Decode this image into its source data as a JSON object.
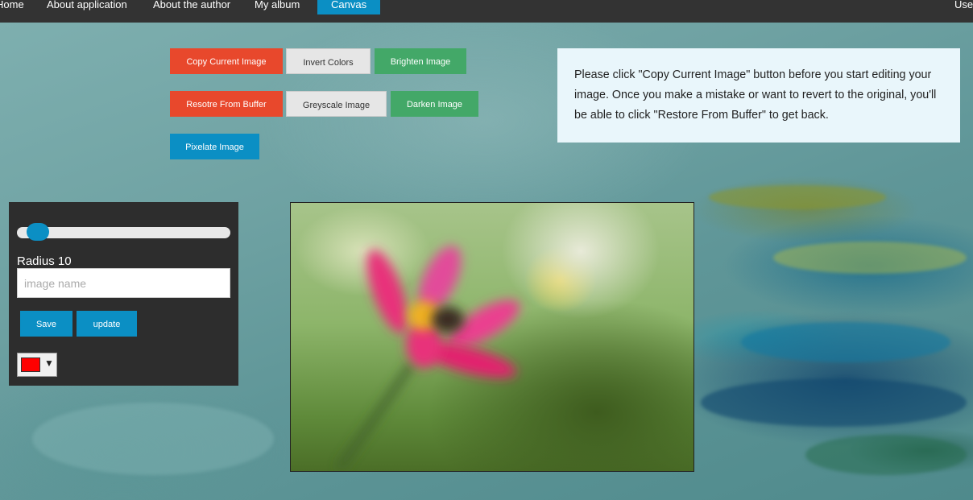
{
  "nav": {
    "items": [
      {
        "label": "Home"
      },
      {
        "label": "About application"
      },
      {
        "label": "About the author"
      },
      {
        "label": "My album"
      },
      {
        "label": "Canvas"
      }
    ],
    "right_label": "User"
  },
  "buttons": {
    "copy": "Copy Current Image",
    "invert": "Invert Colors",
    "brighten": "Brighten Image",
    "restore": "Resotre From Buffer",
    "greyscale": "Greyscale Image",
    "darken": "Darken Image",
    "pixelate": "Pixelate Image"
  },
  "notice": "Please click \"Copy Current Image\" button before you start editing your image. Once you make a mistake or want to revert to the original, you'll be able to click \"Restore From Buffer\" to get back.",
  "panel": {
    "radius_label": "Radius 10",
    "radius_value": 10,
    "slider_fraction": 0.15,
    "name_placeholder": "image name",
    "name_value": "",
    "save_label": "Save",
    "update_label": "update",
    "selected_color": "#ff0000",
    "caret": "▼"
  },
  "colors": {
    "nav_bg": "#333333",
    "active_tab": "#0b8fc4",
    "red_button": "#e8482c",
    "green_button": "#43a868",
    "blue_button": "#0b8fc4",
    "panel_bg": "#2d2d2d"
  },
  "canvas": {
    "image_description_icon": "flower-photo-blurred"
  }
}
